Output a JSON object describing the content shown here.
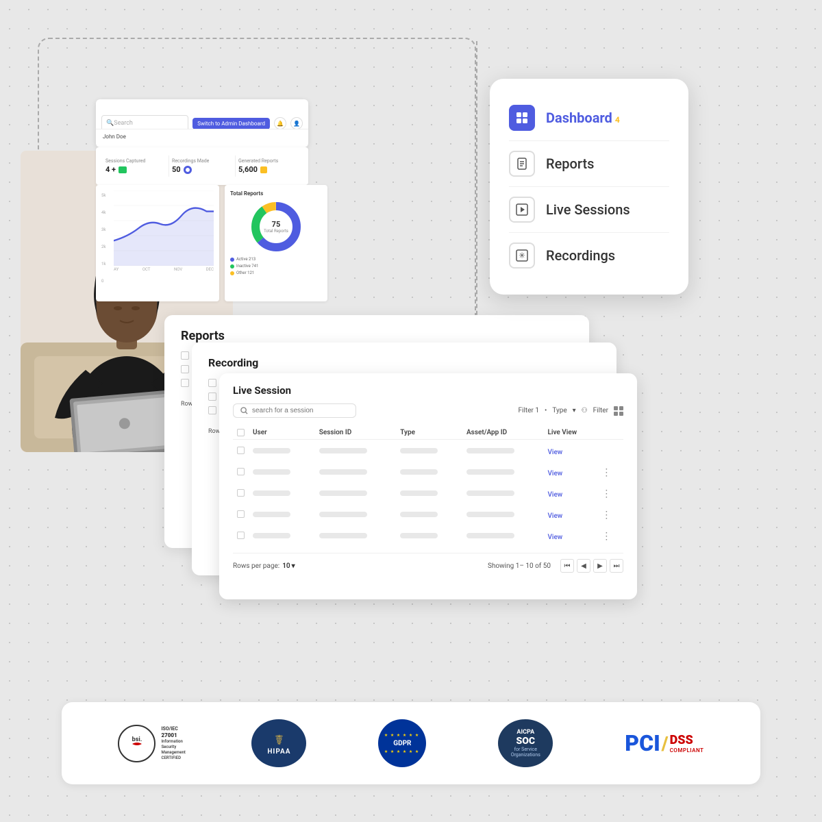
{
  "background": {
    "color": "#e8e8e8"
  },
  "appBar": {
    "searchPlaceholder": "Search",
    "adminButtonLabel": "Switch to Admin Dashboard",
    "userName": "John Doe"
  },
  "stats": {
    "sessions": {
      "label": "Sessions Captured",
      "value": "4 +"
    },
    "recordings": {
      "label": "Recordings Made",
      "value": "50"
    },
    "reports": {
      "label": "Generated Reports",
      "value": "5,600"
    }
  },
  "lineChart": {
    "title": "",
    "yLabels": [
      "5k",
      "4k",
      "3k",
      "2k",
      "1k",
      "0"
    ],
    "xLabels": [
      "AY",
      "OCT",
      "NOV",
      "DEC"
    ]
  },
  "donutChart": {
    "title": "Total Reports",
    "centerValue": "75",
    "centerLabel": "Total Reports",
    "legend": [
      {
        "label": "Active",
        "value": "213",
        "color": "#4f5ce0"
      },
      {
        "label": "Inactive",
        "value": "741",
        "color": "#22c55e"
      },
      {
        "label": "Other",
        "value": "121",
        "color": "#fbbf24"
      }
    ]
  },
  "navMenu": {
    "items": [
      {
        "label": "Dashboard",
        "badge": "4",
        "iconType": "grid",
        "active": true
      },
      {
        "label": "Reports",
        "badge": "",
        "iconType": "report",
        "active": false
      },
      {
        "label": "Live Sessions",
        "badge": "",
        "iconType": "play",
        "active": false
      },
      {
        "label": "Recordings",
        "badge": "",
        "iconType": "asterisk",
        "active": false
      }
    ]
  },
  "reportsPage": {
    "title": "Reports"
  },
  "recordingPage": {
    "title": "Recording"
  },
  "liveSession": {
    "title": "Live Session",
    "searchPlaceholder": "search for a session",
    "filters": {
      "filter1": "Filter 1",
      "type": "Type",
      "filter": "Filter"
    },
    "tableHeaders": [
      "",
      "User",
      "Session ID",
      "Type",
      "Asset/App ID",
      "Live View"
    ],
    "rows": [
      {
        "liveView": "View"
      },
      {
        "liveView": "View"
      },
      {
        "liveView": "View"
      },
      {
        "liveView": "View"
      },
      {
        "liveView": "View"
      }
    ],
    "pagination": {
      "rowsPerPage": "Rows per page:",
      "rowsValue": "10",
      "showing": "Showing 1– 10 of  50"
    }
  },
  "compliance": {
    "logos": [
      {
        "name": "BSI ISO/IEC 27001",
        "type": "bsi"
      },
      {
        "name": "HIPAA",
        "type": "hipaa"
      },
      {
        "name": "GDPR",
        "type": "gdpr"
      },
      {
        "name": "AICPA SOC",
        "type": "aicpa"
      },
      {
        "name": "PCI DSS Compliant",
        "type": "pci"
      }
    ]
  }
}
